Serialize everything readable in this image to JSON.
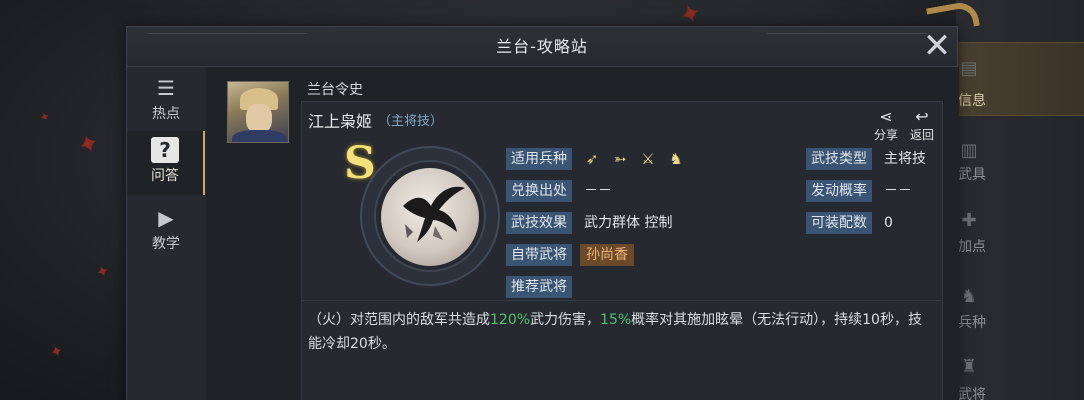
{
  "window": {
    "title": "兰台-攻略站"
  },
  "nav": {
    "items": [
      {
        "label": "热点",
        "icon": "news-icon"
      },
      {
        "label": "问答",
        "icon": "question-icon"
      },
      {
        "label": "教学",
        "icon": "play-icon"
      }
    ],
    "active": "问答"
  },
  "post": {
    "author": "兰台令史",
    "skill_name": "江上枭姬",
    "skill_tag": "（主将技）",
    "share_label": "分享",
    "back_label": "返回",
    "grade": "S"
  },
  "attributes": {
    "unit_type_label": "适用兵种",
    "exchange_label": "兑换出处",
    "exchange_value": "－－",
    "effect_label": "武技效果",
    "effect_value": "武力群体 控制",
    "own_hero_label": "自带武将",
    "own_hero_value": "孙尚香",
    "recommend_label": "推荐武将",
    "skill_type_label": "武技类型",
    "skill_type_value": "主将技",
    "trigger_label": "发动概率",
    "trigger_value": "－－",
    "equip_label": "可装配数",
    "equip_value": "0",
    "unit_icons": [
      "spear-icon",
      "bow-icon",
      "sword-icon",
      "horse-icon"
    ]
  },
  "description": {
    "part1": "（火）对范围内的敌军共造成",
    "damage": "120%",
    "part2": "武力伤害，",
    "chance": "15%",
    "part3": "概率对其施加眩晕（无法行动），持续10秒，技能冷却20秒。"
  },
  "background": {
    "side_labels": [
      "信息",
      "武具",
      "加点",
      "兵种",
      "武将"
    ]
  },
  "colors": {
    "label_bg": "#3a5573",
    "highlight_green": "#4fc26a",
    "hero_chip_bg": "#6b4a2a",
    "grade_gold": "#f4e17a"
  }
}
